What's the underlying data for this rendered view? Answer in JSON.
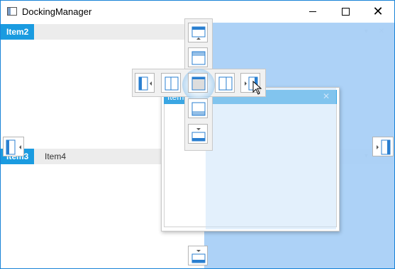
{
  "window": {
    "title": "DockingManager",
    "minimize_symbol": "—",
    "maximize_symbol": "☐",
    "close_symbol": "✕"
  },
  "top_pane": {
    "active_tab": "Item2",
    "buttons": "▾ ✕"
  },
  "bottom_pane": {
    "active_tab": "Item3",
    "other_tab": "Item4",
    "buttons": "▾ ✕"
  },
  "floating_window": {
    "title": "Item1",
    "close_symbol": "✕"
  },
  "colors": {
    "accent": "#1a9be0",
    "preview": "#a9d0f7",
    "window_border": "#1883d7"
  },
  "icons": {
    "app": "app-window-icon",
    "dock_top": "dock-top-icon",
    "dock_bottom": "dock-bottom-icon",
    "dock_left": "dock-left-icon",
    "dock_right": "dock-right-icon",
    "dock_center": "dock-tabbed-icon",
    "cursor": "pointer-cursor-icon"
  }
}
